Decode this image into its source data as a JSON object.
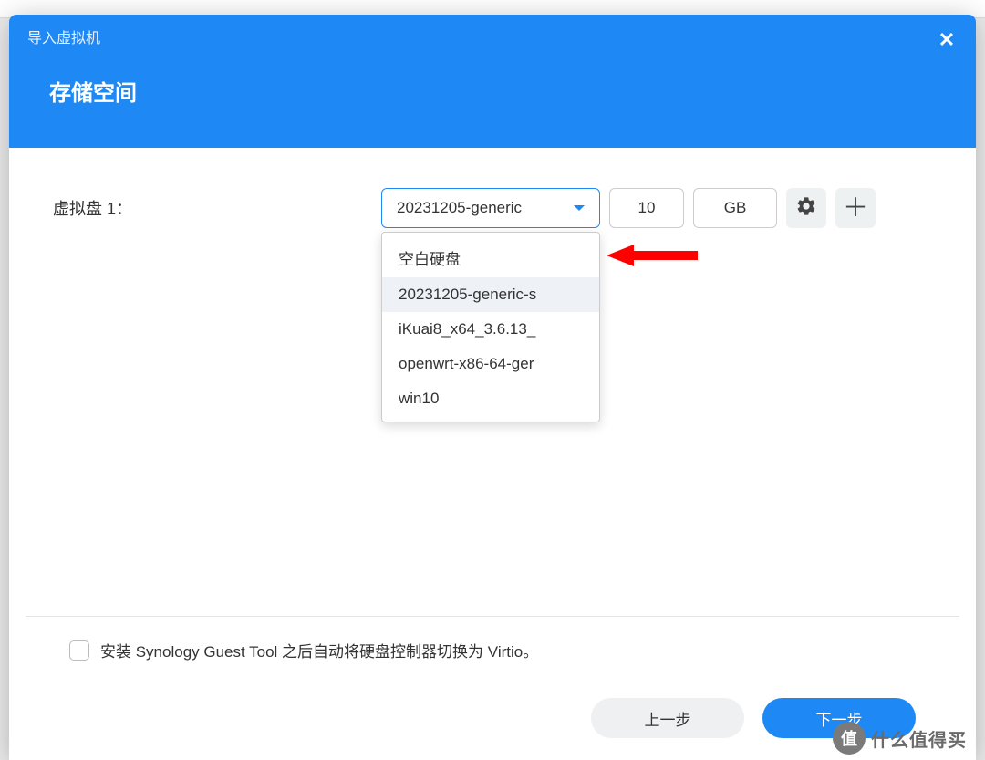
{
  "dialog": {
    "title": "导入虚拟机",
    "section_title": "存储空间"
  },
  "form": {
    "disk_label": "虚拟盘 1：",
    "disk_select": {
      "value": "20231205-generic",
      "options": [
        "空白硬盘",
        "20231205-generic-s",
        "iKuai8_x64_3.6.13_",
        "openwrt-x86-64-ger",
        "win10"
      ],
      "highlighted_index": 1
    },
    "size_value": "10",
    "size_unit": "GB"
  },
  "footer": {
    "checkbox_label": "安装 Synology Guest Tool 之后自动将硬盘控制器切换为 Virtio。",
    "btn_prev": "上一步",
    "btn_next": "下一步"
  },
  "watermark": {
    "badge": "值",
    "text": "什么值得买"
  }
}
